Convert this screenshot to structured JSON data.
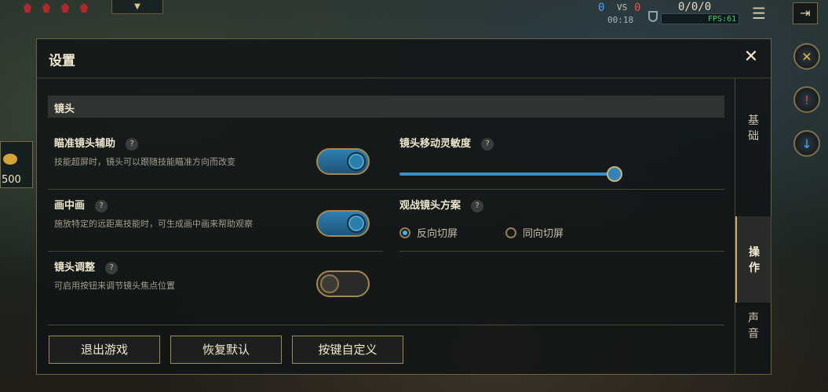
{
  "modal": {
    "title": "设置",
    "close_glyph": "✕"
  },
  "section": {
    "title": "镜头"
  },
  "settings": {
    "aim_assist": {
      "label": "瞄准镜头辅助",
      "description": "技能超屏时，镜头可以跟随技能瞄准方向而改变",
      "enabled": true
    },
    "pip": {
      "label": "画中画",
      "description": "施放特定的远距离技能时，可生成画中画来帮助观察",
      "enabled": true
    },
    "camera_adjust": {
      "label": "镜头调整",
      "description": "可启用按钮来调节镜头焦点位置",
      "enabled": false
    },
    "sensitivity": {
      "label": "镜头移动灵敏度",
      "value_fraction": 1.0
    },
    "spectator": {
      "label": "观战镜头方案",
      "options": [
        "反向切屏",
        "同向切屏"
      ],
      "selected": "反向切屏"
    }
  },
  "help_glyph": "?",
  "footer": {
    "exit_label": "退出游戏",
    "reset_label": "恢复默认",
    "customize_label": "按键自定义"
  },
  "side_tabs": [
    {
      "label": "基础",
      "active": false
    },
    {
      "label": "操作",
      "active": true
    },
    {
      "label": "声音",
      "active": false
    }
  ],
  "hud": {
    "blue_kills": "0",
    "vs": "VS",
    "red_kills": "0",
    "kda": "0/0/0",
    "time": "00:18",
    "fps": "FPS:61",
    "gold": "500",
    "menu_glyph": "☰",
    "exit_glyph": "⇥"
  },
  "colors": {
    "accent_blue": "#3b8fc4",
    "border_gold": "#a08a55",
    "blue_team": "#4aa3ff",
    "red_team": "#ff4a4a"
  }
}
